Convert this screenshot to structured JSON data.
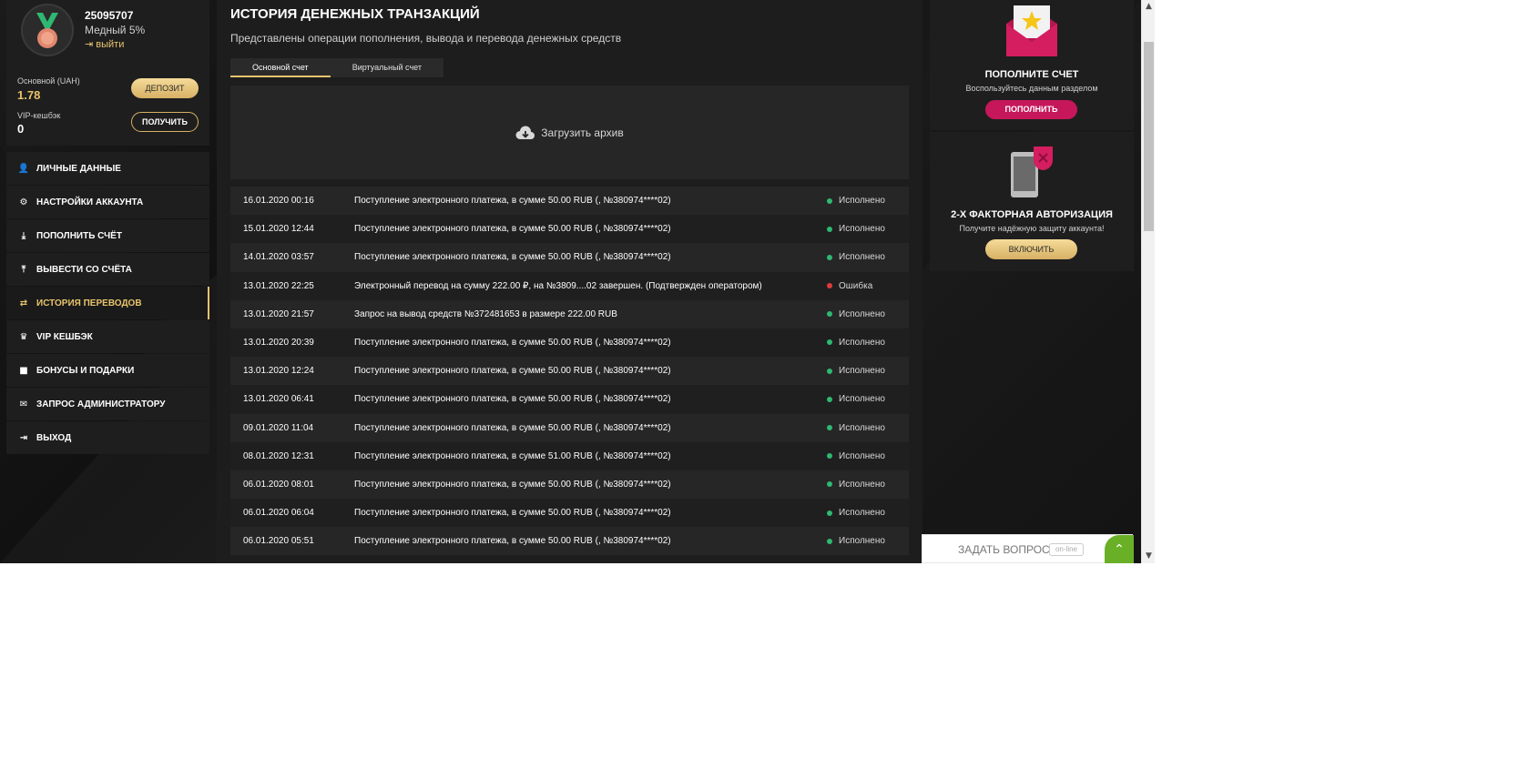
{
  "profile": {
    "user_id": "25095707",
    "rank": "Медный 5%",
    "logout": "выйти",
    "main_account_label": "Основной (UAH)",
    "main_account_value": "1.78",
    "deposit_button": "ДЕПОЗИТ",
    "cashback_label": "VIP-кешбэк",
    "cashback_value": "0",
    "claim_button": "ПОЛУЧИТЬ"
  },
  "menu": [
    {
      "label": "ЛИЧНЫЕ ДАННЫЕ",
      "icon": "user-add-icon"
    },
    {
      "label": "НАСТРОЙКИ АККАУНТА",
      "icon": "gears-icon"
    },
    {
      "label": "ПОПОЛНИТЬ СЧЁТ",
      "icon": "download-icon"
    },
    {
      "label": "ВЫВЕСТИ СО СЧЁТА",
      "icon": "upload-icon"
    },
    {
      "label": "ИСТОРИЯ ПЕРЕВОДОВ",
      "icon": "transfer-arrows-icon",
      "active": true
    },
    {
      "label": "VIP КЕШБЭК",
      "icon": "crown-icon"
    },
    {
      "label": "БОНУСЫ И ПОДАРКИ",
      "icon": "gift-icon"
    },
    {
      "label": "ЗАПРОС АДМИНИСТРАТОРУ",
      "icon": "envelope-icon"
    },
    {
      "label": "ВЫХОД",
      "icon": "logout-icon"
    }
  ],
  "main": {
    "title": "ИСТОРИЯ ДЕНЕЖНЫХ ТРАНЗАКЦИЙ",
    "subtitle": "Представлены операции пополнения, вывода и перевода денежных средств",
    "tabs": [
      {
        "label": "Основной счет",
        "active": true
      },
      {
        "label": "Виртуальный счет",
        "active": false
      }
    ],
    "upload_label": "Загрузить архив",
    "transactions": [
      {
        "date": "16.01.2020 00:16",
        "desc": "Поступление электронного платежа, в сумме 50.00 RUB (, №380974****02)",
        "status": "Исполнено",
        "ok": true
      },
      {
        "date": "15.01.2020 12:44",
        "desc": "Поступление электронного платежа, в сумме 50.00 RUB (, №380974****02)",
        "status": "Исполнено",
        "ok": true
      },
      {
        "date": "14.01.2020 03:57",
        "desc": "Поступление электронного платежа, в сумме 50.00 RUB (, №380974****02)",
        "status": "Исполнено",
        "ok": true
      },
      {
        "date": "13.01.2020 22:25",
        "desc": "Электронный перевод на сумму 222.00 ₽, на №3809....02 завершен. (Подтвержден оператором)",
        "status": "Ошибка",
        "ok": false
      },
      {
        "date": "13.01.2020 21:57",
        "desc": "Запрос на вывод средств №372481653 в размере 222.00 RUB",
        "status": "Исполнено",
        "ok": true
      },
      {
        "date": "13.01.2020 20:39",
        "desc": "Поступление электронного платежа, в сумме 50.00 RUB (, №380974****02)",
        "status": "Исполнено",
        "ok": true
      },
      {
        "date": "13.01.2020 12:24",
        "desc": "Поступление электронного платежа, в сумме 50.00 RUB (, №380974****02)",
        "status": "Исполнено",
        "ok": true
      },
      {
        "date": "13.01.2020 06:41",
        "desc": "Поступление электронного платежа, в сумме 50.00 RUB (, №380974****02)",
        "status": "Исполнено",
        "ok": true
      },
      {
        "date": "09.01.2020 11:04",
        "desc": "Поступление электронного платежа, в сумме 50.00 RUB (, №380974****02)",
        "status": "Исполнено",
        "ok": true
      },
      {
        "date": "08.01.2020 12:31",
        "desc": "Поступление электронного платежа, в сумме 51.00 RUB (, №380974****02)",
        "status": "Исполнено",
        "ok": true
      },
      {
        "date": "06.01.2020 08:01",
        "desc": "Поступление электронного платежа, в сумме 50.00 RUB (, №380974****02)",
        "status": "Исполнено",
        "ok": true
      },
      {
        "date": "06.01.2020 06:04",
        "desc": "Поступление электронного платежа, в сумме 50.00 RUB (, №380974****02)",
        "status": "Исполнено",
        "ok": true
      },
      {
        "date": "06.01.2020 05:51",
        "desc": "Поступление электронного платежа, в сумме 50.00 RUB (, №380974****02)",
        "status": "Исполнено",
        "ok": true
      }
    ]
  },
  "promo_deposit": {
    "title": "ПОПОЛНИТЕ СЧЕТ",
    "subtitle": "Воспользуйтесь данным разделом",
    "button": "ПОПОЛНИТЬ"
  },
  "promo_2fa": {
    "title": "2-Х ФАКТОРНАЯ АВТОРИЗАЦИЯ",
    "subtitle": "Получите надёжную защиту аккаунта!",
    "button": "ВКЛЮЧИТЬ"
  },
  "chat": {
    "label": "ЗАДАТЬ ВОПРОС",
    "badge": "on-line"
  },
  "colors": {
    "gold": "#e8c46c",
    "pink": "#c5175a",
    "success": "#2eb872",
    "error": "#e03b3b",
    "chat_green": "#6ab027"
  }
}
